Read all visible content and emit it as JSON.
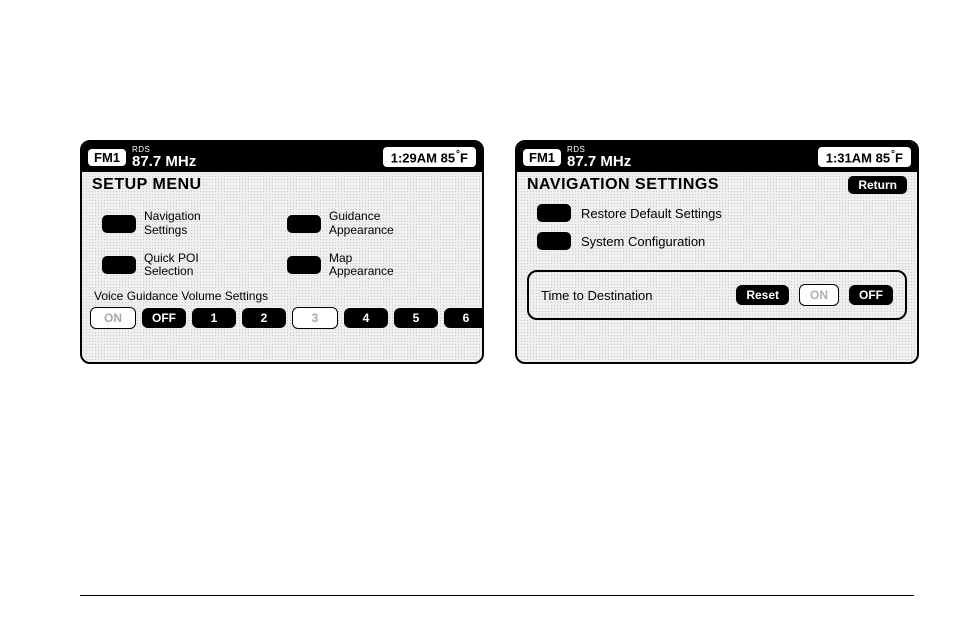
{
  "left": {
    "header": {
      "band": "FM1",
      "rds": "RDS",
      "freq": "87.7 MHz",
      "clock": "1:29AM 85",
      "deg": "°",
      "unit": "F"
    },
    "title": "SETUP MENU",
    "items": [
      {
        "label": "Navigation\nSettings"
      },
      {
        "label": "Guidance\nAppearance"
      },
      {
        "label": "Quick POI\nSelection"
      },
      {
        "label": "Map\nAppearance"
      }
    ],
    "voice_title": "Voice Guidance Volume Settings",
    "voice_buttons": [
      {
        "label": "ON",
        "hollow": true
      },
      {
        "label": "OFF",
        "hollow": false
      },
      {
        "label": "1",
        "hollow": false
      },
      {
        "label": "2",
        "hollow": false
      },
      {
        "label": "3",
        "hollow": true
      },
      {
        "label": "4",
        "hollow": false
      },
      {
        "label": "5",
        "hollow": false
      },
      {
        "label": "6",
        "hollow": false
      }
    ]
  },
  "right": {
    "header": {
      "band": "FM1",
      "rds": "RDS",
      "freq": "87.7 MHz",
      "clock": "1:31AM 85",
      "deg": "°",
      "unit": "F"
    },
    "title": "NAVIGATION SETTINGS",
    "return_label": "Return",
    "items": [
      {
        "label": "Restore Default Settings"
      },
      {
        "label": "System Configuration"
      }
    ],
    "time_panel": {
      "label": "Time to Destination",
      "reset": "Reset",
      "on": "ON",
      "off": "OFF"
    }
  }
}
